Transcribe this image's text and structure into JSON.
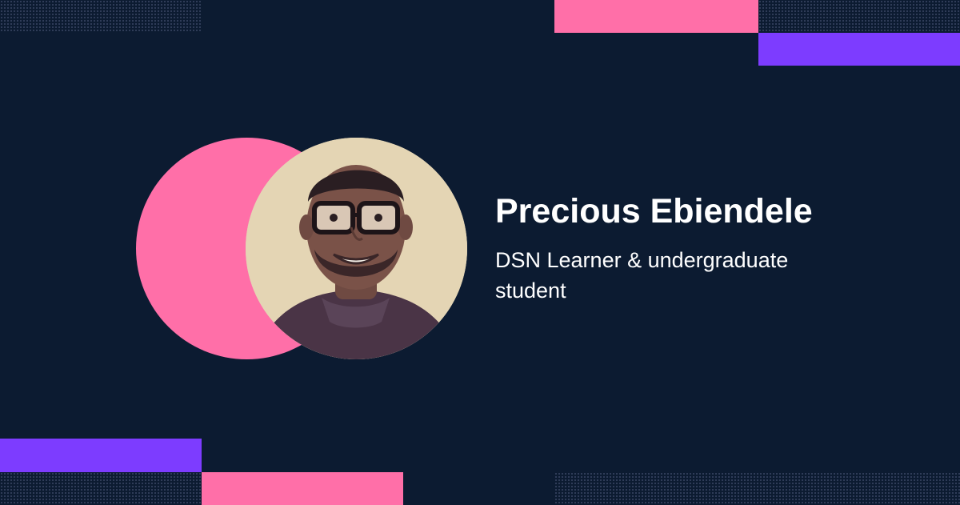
{
  "profile": {
    "name": "Precious Ebiendele",
    "role": "DSN Learner & undergraduate student"
  },
  "colors": {
    "background": "#0c1b31",
    "pink": "#ff6fa8",
    "purple": "#7d3cff",
    "text": "#ffffff"
  },
  "icons": {
    "photo": "person-portrait"
  }
}
